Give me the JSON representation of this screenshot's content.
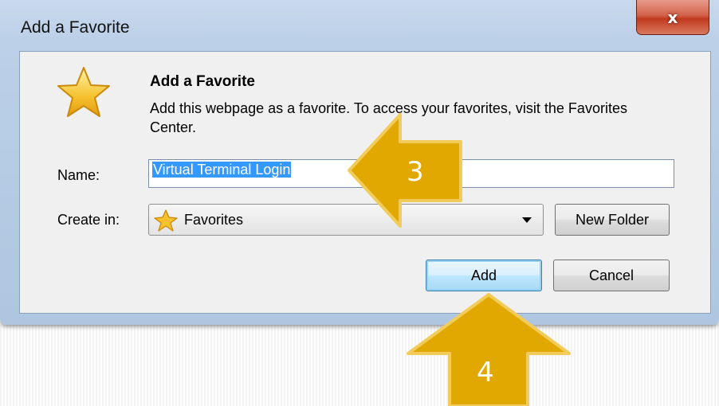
{
  "dialog": {
    "title": "Add a Favorite",
    "close_label": "x",
    "heading": "Add a Favorite",
    "description": "Add this webpage as a favorite. To access your favorites, visit the Favorites Center.",
    "name_label": "Name:",
    "name_value": "Virtual Terminal Login",
    "create_in_label": "Create in:",
    "create_in_value": "Favorites",
    "new_folder_label": "New Folder",
    "add_label": "Add",
    "cancel_label": "Cancel"
  },
  "annotations": [
    {
      "number": "3",
      "direction": "left"
    },
    {
      "number": "4",
      "direction": "up"
    }
  ],
  "colors": {
    "annotation_fill": "#e0a800",
    "annotation_stroke": "#f2cc5a",
    "selection": "#3399ff",
    "close_button": "#c0391f"
  }
}
